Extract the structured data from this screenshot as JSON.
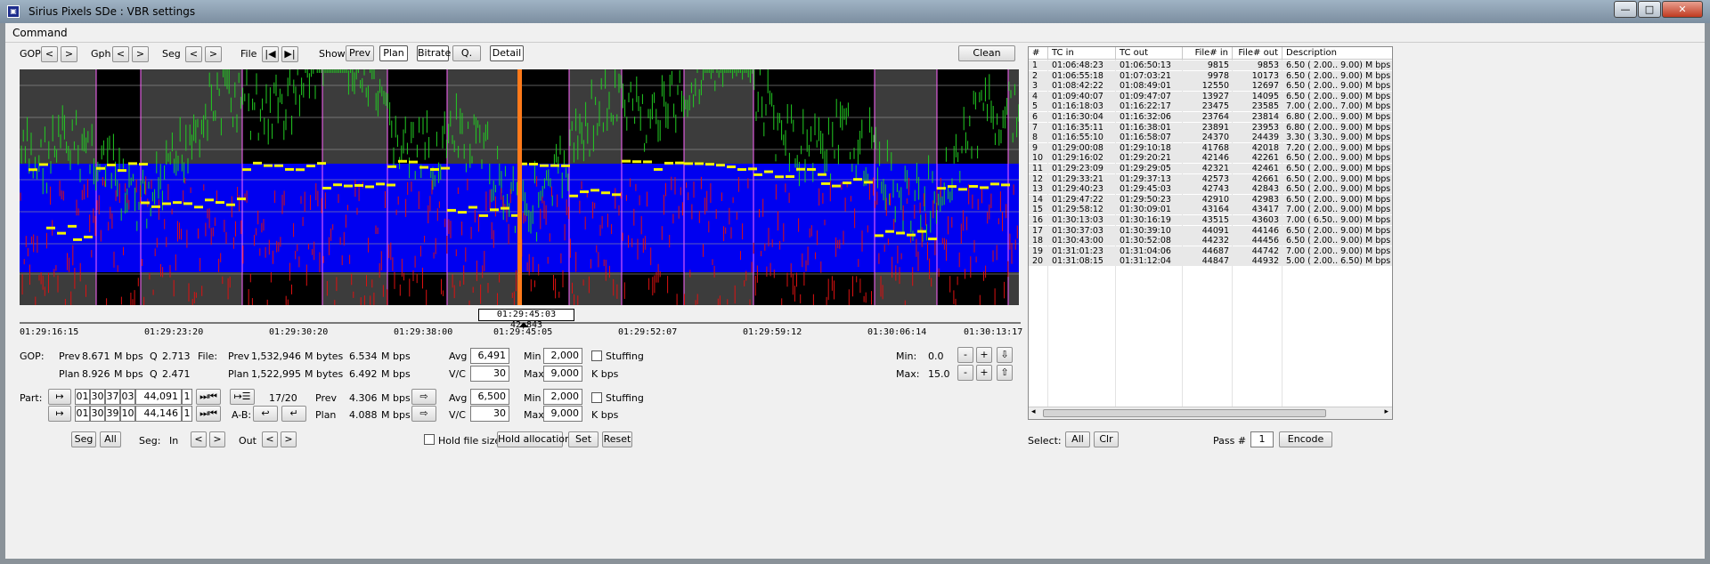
{
  "window": {
    "title": "Sirius Pixels SDe : VBR settings",
    "app_icon": "app-logo-icon",
    "controls": [
      "—",
      "□",
      "✕"
    ]
  },
  "menu": {
    "command": "Command"
  },
  "toolbar": {
    "gop": "GOP",
    "gph": "Gph",
    "seg": "Seg",
    "file": "File",
    "show": "Show",
    "prev": "Prev",
    "plan": "Plan",
    "bitrate": "Bitrate",
    "q": "Q.",
    "detail": "Detail",
    "clean": "Clean",
    "lt": "<",
    "gt": ">",
    "first": "|◀",
    "last": "▶|"
  },
  "timeline": {
    "readout": "01:29:45:03 42,843",
    "ticks": [
      "01:29:16:15",
      "01:29:23:20",
      "01:29:30:20",
      "01:29:38:00",
      "01:29:45:05",
      "01:29:52:07",
      "01:29:59:12",
      "01:30:06:14",
      "01:30:13:17"
    ]
  },
  "gop_stats": {
    "label": "GOP:",
    "file_label": "File:",
    "prev_label": "Prev",
    "plan_label": "Plan",
    "prev_rate": "8.671",
    "plan_rate": "8.926",
    "mbps": "M bps",
    "q_label": "Q",
    "prev_q": "2.713",
    "plan_q": "2.471",
    "file_prev_bytes": "1,532,946",
    "file_plan_bytes": "1,522,995",
    "mbytes": "M bytes",
    "file_prev_rate": "6.534",
    "file_plan_rate": "6.492",
    "avg_label": "Avg",
    "vc_label": "V/C",
    "min_label": "Min",
    "max_label": "Max",
    "avg": "6,491",
    "vc": "30",
    "min": "2,000",
    "max": "9,000",
    "stuffing": "Stuffing",
    "kbps": "K bps",
    "min_right_label": "Min:",
    "max_right_label": "Max:",
    "min_right": "0.0",
    "max_right": "15.0",
    "minus": "-",
    "plus": "+",
    "down": "⇩",
    "up": "⇧"
  },
  "part": {
    "label": "Part:",
    "row1": [
      "01",
      "30",
      "37",
      "03",
      "44,091",
      "1"
    ],
    "row2": [
      "01",
      "30",
      "39",
      "10",
      "44,146",
      "1"
    ],
    "count": "17/20",
    "ab": "A-B:",
    "prev_label": "Prev",
    "plan_label": "Plan",
    "prev_rate": "4.306",
    "plan_rate": "4.088",
    "mbps": "M bps",
    "avg": "6,500",
    "vc": "30",
    "min": "2,000",
    "max": "9,000",
    "avg_label": "Avg",
    "vc_label": "V/C",
    "min_label": "Min",
    "max_label": "Max",
    "stuffing": "Stuffing",
    "kbps": "K bps"
  },
  "bottom": {
    "seg": "Seg",
    "all": "All",
    "seg_label": "Seg:",
    "in": "In",
    "out": "Out",
    "lt": "<",
    "gt": ">",
    "hold_file_size": "Hold file size",
    "hold_allocation": "Hold allocation",
    "set": "Set",
    "reset": "Reset",
    "select_label": "Select:",
    "sel_all": "All",
    "sel_clr": "Clr",
    "pass_label": "Pass #",
    "pass_value": "1",
    "encode": "Encode"
  },
  "table": {
    "headers": [
      "#",
      "TC in",
      "TC out",
      "File# in",
      "File# out",
      "Description"
    ],
    "rows": [
      [
        "1",
        "01:06:48:23",
        "01:06:50:13",
        "9815",
        "9853",
        "6.50 ( 2.00.. 9.00) M bps"
      ],
      [
        "2",
        "01:06:55:18",
        "01:07:03:21",
        "9978",
        "10173",
        "6.50 ( 2.00.. 9.00) M bps"
      ],
      [
        "3",
        "01:08:42:22",
        "01:08:49:01",
        "12550",
        "12697",
        "6.50 ( 2.00.. 9.00) M bps"
      ],
      [
        "4",
        "01:09:40:07",
        "01:09:47:07",
        "13927",
        "14095",
        "6.50 ( 2.00.. 9.00) M bps"
      ],
      [
        "5",
        "01:16:18:03",
        "01:16:22:17",
        "23475",
        "23585",
        "7.00 ( 2.00.. 7.00) M bps"
      ],
      [
        "6",
        "01:16:30:04",
        "01:16:32:06",
        "23764",
        "23814",
        "6.80 ( 2.00.. 9.00) M bps"
      ],
      [
        "7",
        "01:16:35:11",
        "01:16:38:01",
        "23891",
        "23953",
        "6.80 ( 2.00.. 9.00) M bps"
      ],
      [
        "8",
        "01:16:55:10",
        "01:16:58:07",
        "24370",
        "24439",
        "3.30 ( 3.30.. 9.00) M bps"
      ],
      [
        "9",
        "01:29:00:08",
        "01:29:10:18",
        "41768",
        "42018",
        "7.20 ( 2.00.. 9.00) M bps"
      ],
      [
        "10",
        "01:29:16:02",
        "01:29:20:21",
        "42146",
        "42261",
        "6.50 ( 2.00.. 9.00) M bps"
      ],
      [
        "11",
        "01:29:23:09",
        "01:29:29:05",
        "42321",
        "42461",
        "6.50 ( 2.00.. 9.00) M bps"
      ],
      [
        "12",
        "01:29:33:21",
        "01:29:37:13",
        "42573",
        "42661",
        "6.50 ( 2.00.. 9.00) M bps"
      ],
      [
        "13",
        "01:29:40:23",
        "01:29:45:03",
        "42743",
        "42843",
        "6.50 ( 2.00.. 9.00) M bps"
      ],
      [
        "14",
        "01:29:47:22",
        "01:29:50:23",
        "42910",
        "42983",
        "6.50 ( 2.00.. 9.00) M bps"
      ],
      [
        "15",
        "01:29:58:12",
        "01:30:09:01",
        "43164",
        "43417",
        "7.00 ( 2.00.. 9.00) M bps"
      ],
      [
        "16",
        "01:30:13:03",
        "01:30:16:19",
        "43515",
        "43603",
        "7.00 ( 6.50.. 9.00) M bps"
      ],
      [
        "17",
        "01:30:37:03",
        "01:30:39:10",
        "44091",
        "44146",
        "6.50 ( 2.00.. 9.00) M bps"
      ],
      [
        "18",
        "01:30:43:00",
        "01:30:52:08",
        "44232",
        "44456",
        "6.50 ( 2.00.. 9.00) M bps"
      ],
      [
        "19",
        "01:31:01:23",
        "01:31:04:06",
        "44687",
        "44742",
        "7.00 ( 2.00.. 9.00) M bps"
      ],
      [
        "20",
        "01:31:08:15",
        "01:31:12:04",
        "44847",
        "44932",
        "5.00 ( 2.00.. 6.50) M bps"
      ]
    ]
  },
  "colors": {
    "plot_bg": "#000000",
    "segment_bg": "#3c3c3c",
    "plan_band": "#0000f0",
    "prev_trace": "#22cc22",
    "frame_trace": "#dd1111",
    "plan_level": "#f4f400",
    "cursor": "#ff7a1a",
    "boundary": "#ff66ff"
  }
}
